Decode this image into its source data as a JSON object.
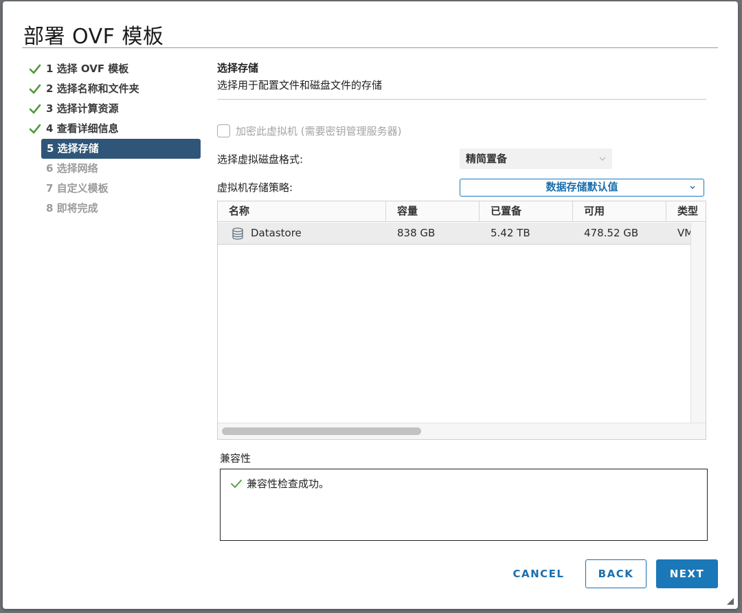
{
  "dialog": {
    "title": "部署 OVF 模板"
  },
  "steps": [
    {
      "label": "1 选择 OVF 模板",
      "state": "done"
    },
    {
      "label": "2 选择名称和文件夹",
      "state": "done"
    },
    {
      "label": "3 选择计算资源",
      "state": "done"
    },
    {
      "label": "4 查看详细信息",
      "state": "done"
    },
    {
      "label": "5 选择存储",
      "state": "active"
    },
    {
      "label": "6 选择网络",
      "state": "pending"
    },
    {
      "label": "7 自定义模板",
      "state": "pending"
    },
    {
      "label": "8 即将完成",
      "state": "pending"
    }
  ],
  "storage": {
    "title": "选择存储",
    "subtitle": "选择用于配置文件和磁盘文件的存储",
    "encrypt_label": "加密此虚拟机 (需要密钥管理服务器)",
    "disk_format_label": "选择虚拟磁盘格式:",
    "disk_format_value": "精简置备",
    "policy_label": "虚拟机存储策略:",
    "policy_value": "数据存储默认值"
  },
  "table": {
    "columns": [
      "名称",
      "容量",
      "已置备",
      "可用",
      "类型"
    ],
    "rows": [
      {
        "name": "Datastore",
        "capacity": "838 GB",
        "provisioned": "5.42 TB",
        "free": "478.52 GB",
        "type": "VM"
      }
    ]
  },
  "compatibility": {
    "label": "兼容性",
    "message": "兼容性检查成功。"
  },
  "footer": {
    "cancel": "CANCEL",
    "back": "BACK",
    "next": "NEXT"
  },
  "colors": {
    "accent": "#1b78b8",
    "active_step_bg": "#2f5678",
    "check_green": "#4e9a3a"
  }
}
